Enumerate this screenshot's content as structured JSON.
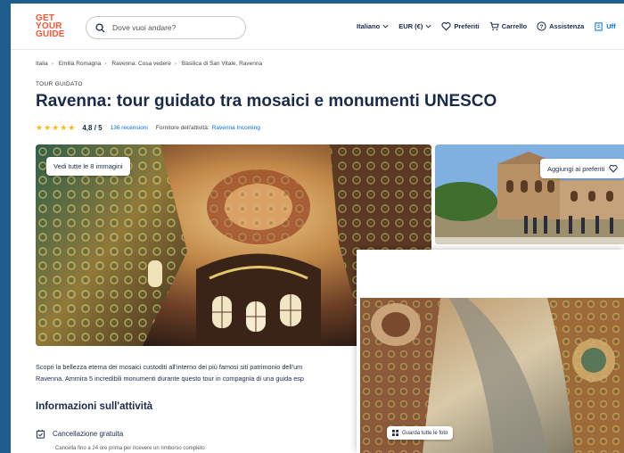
{
  "header": {
    "logo_lines": [
      "GET",
      "YOUR",
      "GUIDE"
    ],
    "search_placeholder": "Dove vuoi andare?",
    "nav": {
      "language": "Italiano",
      "currency": "EUR (€)",
      "favorites": "Preferiti",
      "cart": "Carrello",
      "help": "Assistenza",
      "office": "Uff"
    }
  },
  "breadcrumbs": [
    "Italia",
    "Emilia Romagna",
    "Ravenna: Cosa vedere",
    "Basilica di San Vitale, Ravenna"
  ],
  "kicker": "TOUR GUIDATO",
  "title": "Ravenna: tour guidato tra mosaici e monumenti UNESCO",
  "rating": {
    "stars": "★★★★★",
    "score": "4,8 / 5",
    "reviews": "136 recensioni",
    "supplier_label": "Fornitore dell'attività:",
    "supplier_name": "Ravenna Incoming"
  },
  "gallery": {
    "see_all": "Vedi tutte le 8 immagini",
    "add_favorites": "Aggiungi ai preferiti"
  },
  "description": [
    "Scopri la bellezza eterna dei mosaici custoditi all'interno dei più famosi siti patrimonio dell'um",
    "Ravenna. Ammira 5 incredibili monumenti durante questo tour in compagnia di una guida esp"
  ],
  "info": {
    "title": "Informazioni sull'attività",
    "cancellation": "Cancellazione gratuita",
    "cancellation_note": "Cancella fino a 24 ore prima per ricevere un rimborso completo"
  },
  "overlay": {
    "see_photos": "Guarda tutte le foto"
  },
  "colors": {
    "brand": "#ff5533",
    "navy": "#1a2b49",
    "link": "#0071eb",
    "star": "#fdb813",
    "backdrop": "#1f5d8c"
  }
}
